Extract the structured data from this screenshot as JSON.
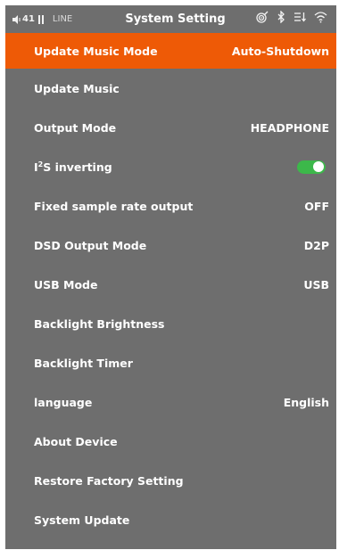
{
  "status_bar": {
    "volume_icon": "speaker-icon",
    "volume": "41",
    "battery_icon": "bars-icon",
    "line_label": "LINE",
    "title": "System Setting",
    "right_icons": [
      "target-icon",
      "bluetooth-icon",
      "list-download-icon",
      "wifi-icon"
    ]
  },
  "menu": {
    "items": [
      {
        "label": "Update Music Mode",
        "value": "Auto-Shutdown"
      },
      {
        "label": "Update Music",
        "value": ""
      },
      {
        "label": "Output Mode",
        "value": "HEADPHONE"
      },
      {
        "label_main": "I",
        "label_sup": "2",
        "label_rest": "S inverting",
        "toggle": "on"
      },
      {
        "label": "Fixed sample rate output",
        "value": "OFF"
      },
      {
        "label": "DSD Output Mode",
        "value": "D2P"
      },
      {
        "label": "USB Mode",
        "value": "USB"
      },
      {
        "label": "Backlight Brightness",
        "value": ""
      },
      {
        "label": "Backlight Timer",
        "value": ""
      },
      {
        "label": "language",
        "value": "English"
      },
      {
        "label": "About Device",
        "value": ""
      },
      {
        "label": "Restore Factory Setting",
        "value": ""
      },
      {
        "label": "System Update",
        "value": ""
      }
    ]
  },
  "colors": {
    "background": "#6e6e6e",
    "selected": "#ee5a06",
    "toggle_on": "#3cb84a",
    "text": "#ffffff"
  }
}
